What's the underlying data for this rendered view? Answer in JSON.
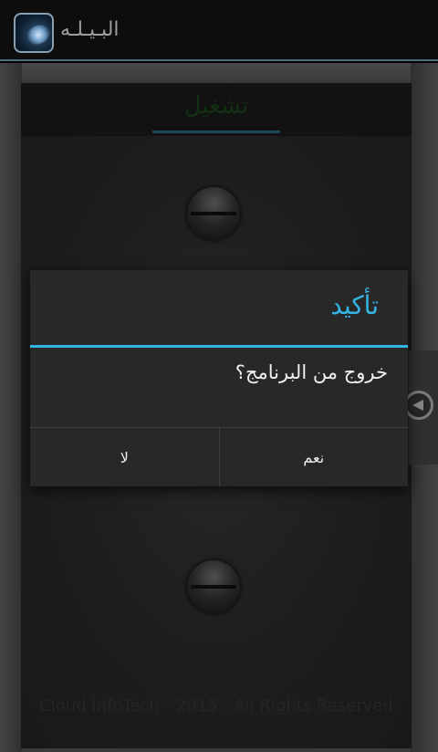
{
  "app": {
    "title": "البـيـلـه",
    "icon": "flashlight-app-icon"
  },
  "tab": {
    "label": "تشغيل"
  },
  "footer": {
    "text": "Cloud InfoTech - 2015 - All Rights Reserved"
  },
  "drawer": {
    "icon": "left-arrow-circle-icon"
  },
  "dialog": {
    "title": "تأكيد",
    "message": "خروج من البرنامج؟",
    "no_label": "لا",
    "yes_label": "نعم"
  },
  "colors": {
    "accent": "#33b5e5",
    "tab_text": "#1e4a1e",
    "dialog_bg": "#282828"
  }
}
